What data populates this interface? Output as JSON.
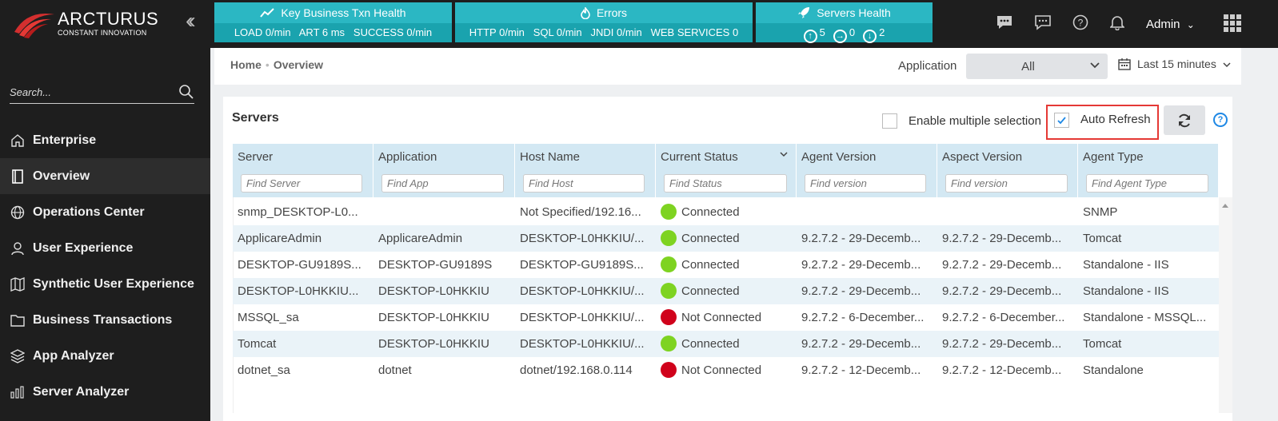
{
  "brand": {
    "title": "ARCTURUS",
    "tagline": "CONSTANT INNOVATION",
    "accent": "#d32f2f"
  },
  "kpis": {
    "business": {
      "title": "Key Business Txn Health",
      "values": "LOAD 0/min   ART 6 ms   SUCCESS 0/min",
      "icon": "trend-icon"
    },
    "errors": {
      "title": "Errors",
      "values": "HTTP 0/min   SQL 0/min   JNDI 0/min   WEB SERVICES 0",
      "icon": "fire-icon"
    },
    "servers": {
      "title": "Servers Health",
      "up": "5",
      "right": "0",
      "down": "2",
      "icon": "rocket-icon"
    }
  },
  "topbar": {
    "user": "Admin"
  },
  "sidebar": {
    "search_placeholder": "Search...",
    "items": [
      {
        "label": "Enterprise",
        "icon": "home-icon"
      },
      {
        "label": "Overview",
        "icon": "book-icon",
        "active": true
      },
      {
        "label": "Operations Center",
        "icon": "globe-icon"
      },
      {
        "label": "User Experience",
        "icon": "user-icon"
      },
      {
        "label": "Synthetic User Experience",
        "icon": "map-icon"
      },
      {
        "label": "Business Transactions",
        "icon": "folder-icon"
      },
      {
        "label": "App Analyzer",
        "icon": "layers-icon"
      },
      {
        "label": "Server Analyzer",
        "icon": "bars-icon"
      }
    ]
  },
  "breadcrumb": {
    "home": "Home",
    "current": "Overview"
  },
  "filters": {
    "application_label": "Application",
    "application_value": "All",
    "time_range": "Last 15 minutes"
  },
  "panel": {
    "title": "Servers",
    "multi_select_label": "Enable multiple selection",
    "auto_refresh_label": "Auto Refresh",
    "auto_refresh_checked": true
  },
  "table": {
    "columns": [
      {
        "label": "Server",
        "placeholder": "Find Server"
      },
      {
        "label": "Application",
        "placeholder": "Find App"
      },
      {
        "label": "Host Name",
        "placeholder": "Find Host"
      },
      {
        "label": "Current Status",
        "placeholder": "Find Status"
      },
      {
        "label": "Agent Version",
        "placeholder": "Find version"
      },
      {
        "label": "Aspect Version",
        "placeholder": "Find version"
      },
      {
        "label": "Agent Type",
        "placeholder": "Find Agent Type"
      }
    ],
    "status_colors": {
      "Connected": "#7ed321",
      "Not Connected": "#d0021b"
    },
    "rows": [
      {
        "server": "snmp_DESKTOP-L0...",
        "application": "",
        "host": "Not Specified/192.16...",
        "status": "Connected",
        "agent_version": "",
        "aspect_version": "",
        "agent_type": "SNMP"
      },
      {
        "server": "ApplicareAdmin",
        "application": "ApplicareAdmin",
        "host": "DESKTOP-L0HKKIU/...",
        "status": "Connected",
        "agent_version": "9.2.7.2 - 29-Decemb...",
        "aspect_version": "9.2.7.2 - 29-Decemb...",
        "agent_type": "Tomcat"
      },
      {
        "server": "DESKTOP-GU9189S...",
        "application": "DESKTOP-GU9189S",
        "host": "DESKTOP-GU9189S...",
        "status": "Connected",
        "agent_version": "9.2.7.2 - 29-Decemb...",
        "aspect_version": "9.2.7.2 - 29-Decemb...",
        "agent_type": "Standalone - IIS"
      },
      {
        "server": "DESKTOP-L0HKKIU...",
        "application": "DESKTOP-L0HKKIU",
        "host": "DESKTOP-L0HKKIU/...",
        "status": "Connected",
        "agent_version": "9.2.7.2 - 29-Decemb...",
        "aspect_version": "9.2.7.2 - 29-Decemb...",
        "agent_type": "Standalone - IIS"
      },
      {
        "server": "MSSQL_sa",
        "application": "DESKTOP-L0HKKIU",
        "host": "DESKTOP-L0HKKIU/...",
        "status": "Not Connected",
        "agent_version": "9.2.7.2 - 6-December...",
        "aspect_version": "9.2.7.2 - 6-December...",
        "agent_type": "Standalone - MSSQL..."
      },
      {
        "server": "Tomcat",
        "application": "DESKTOP-L0HKKIU",
        "host": "DESKTOP-L0HKKIU/...",
        "status": "Connected",
        "agent_version": "9.2.7.2 - 29-Decemb...",
        "aspect_version": "9.2.7.2 - 29-Decemb...",
        "agent_type": "Tomcat"
      },
      {
        "server": "dotnet_sa",
        "application": "dotnet",
        "host": "dotnet/192.168.0.114",
        "status": "Not Connected",
        "agent_version": "9.2.7.2 - 12-Decemb...",
        "aspect_version": "9.2.7.2 - 12-Decemb...",
        "agent_type": "Standalone"
      }
    ]
  }
}
